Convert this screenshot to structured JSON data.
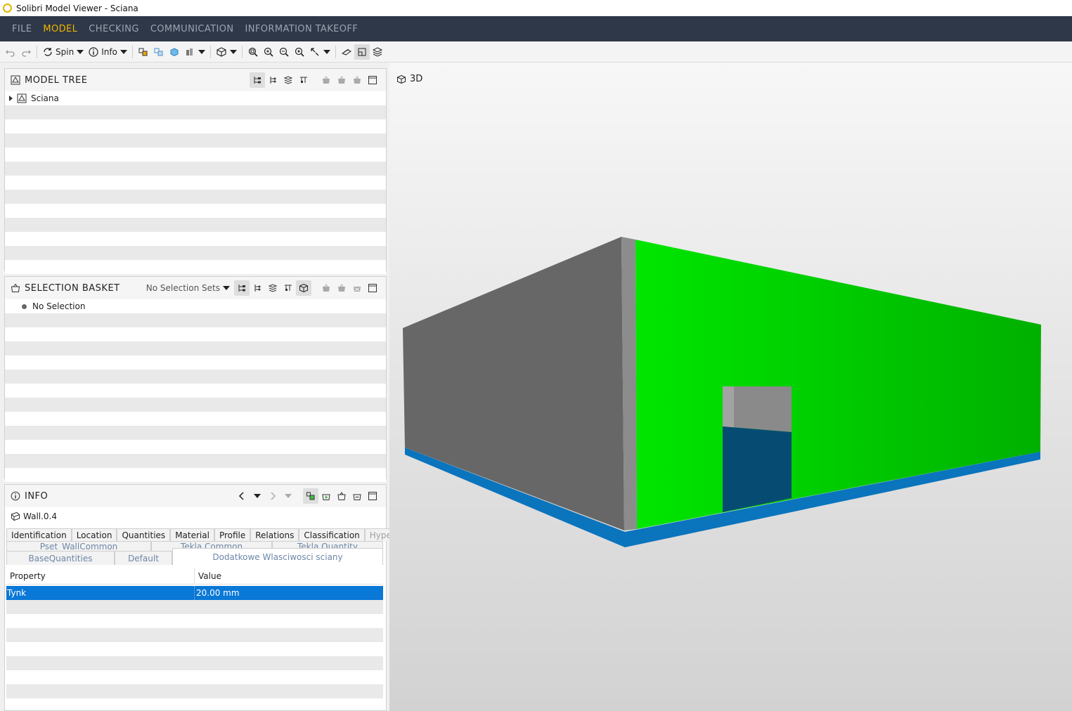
{
  "window": {
    "title": "Solibri Model Viewer - Sciana"
  },
  "menu": [
    {
      "label": "FILE",
      "active": false
    },
    {
      "label": "MODEL",
      "active": true
    },
    {
      "label": "CHECKING",
      "active": false
    },
    {
      "label": "COMMUNICATION",
      "active": false
    },
    {
      "label": "INFORMATION TAKEOFF",
      "active": false
    }
  ],
  "toolbar": {
    "spin_label": "Spin",
    "info_label": "Info"
  },
  "model_tree": {
    "title": "MODEL TREE",
    "items": [
      {
        "label": "Sciana"
      }
    ]
  },
  "selection_basket": {
    "title": "SELECTION BASKET",
    "selection_sets": "No Selection Sets",
    "items": [
      {
        "label": "No Selection"
      }
    ]
  },
  "info": {
    "title": "INFO",
    "object_name": "Wall.0.4",
    "tabs_row1": [
      "Identification",
      "Location",
      "Quantities",
      "Material",
      "Profile",
      "Relations",
      "Classification",
      "Hyperlinks"
    ],
    "tabs_row2": [
      "Pset_WallCommon",
      "Tekla Common",
      "Tekla Quantity"
    ],
    "tabs_row3": [
      "BaseQuantities",
      "Default",
      "Dodatkowe Wlasciwosci sciany"
    ],
    "selected_tab": "Dodatkowe Wlasciwosci sciany",
    "columns": {
      "property": "Property",
      "value": "Value"
    },
    "rows": [
      {
        "property": "Tynk",
        "value": "20.00 mm"
      }
    ]
  },
  "viewport": {
    "label": "3D",
    "colors": {
      "wall_gray": "#676767",
      "wall_green": "#00e600",
      "slab_blue": "#0a74bd",
      "door_blue": "#064c72"
    }
  }
}
